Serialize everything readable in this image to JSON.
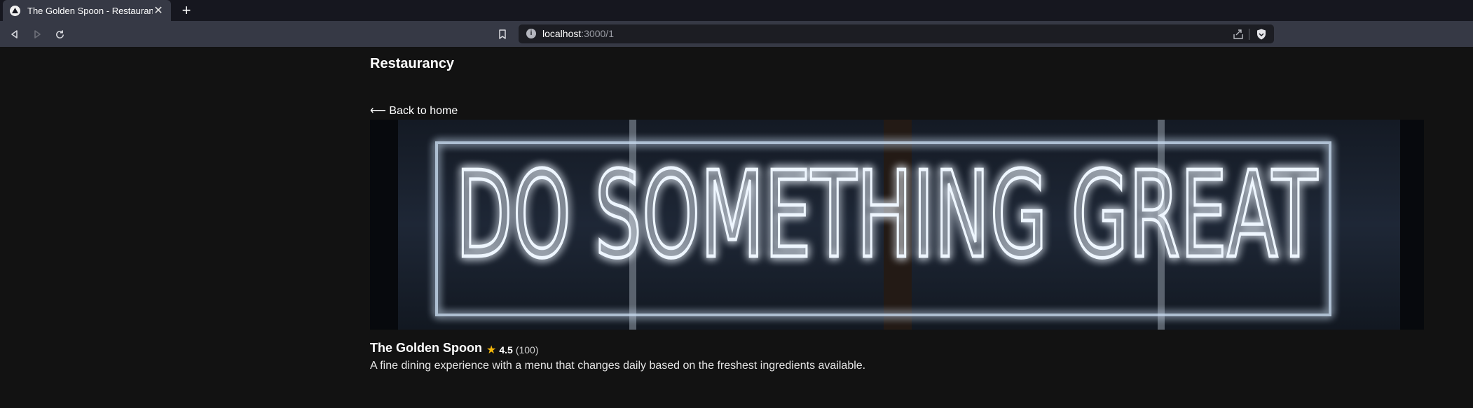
{
  "browser": {
    "tab_title": "The Golden Spoon - Restaurancy",
    "close_symbol": "✕",
    "new_tab_symbol": "+",
    "url_host": "localhost",
    "url_rest": ":3000/1",
    "info_symbol": "i"
  },
  "site": {
    "brand": "Restaurancy",
    "back_link": "⟵ Back to home"
  },
  "hero": {
    "sign_text": "DO SOMETHING GREAT"
  },
  "restaurant": {
    "name": "The Golden Spoon",
    "star": "★",
    "rating": "4.5",
    "review_count": "(100)",
    "description": "A fine dining experience with a menu that changes daily based on the freshest ingredients available."
  },
  "colors": {
    "page_bg": "#121212",
    "toolbar_bg": "#363945",
    "star": "#f5b70a"
  },
  "icons": [
    "back-arrow-icon",
    "forward-arrow-icon",
    "reload-icon",
    "bookmark-icon",
    "info-icon",
    "share-icon",
    "shield-icon",
    "close-icon",
    "plus-icon",
    "star-icon"
  ]
}
